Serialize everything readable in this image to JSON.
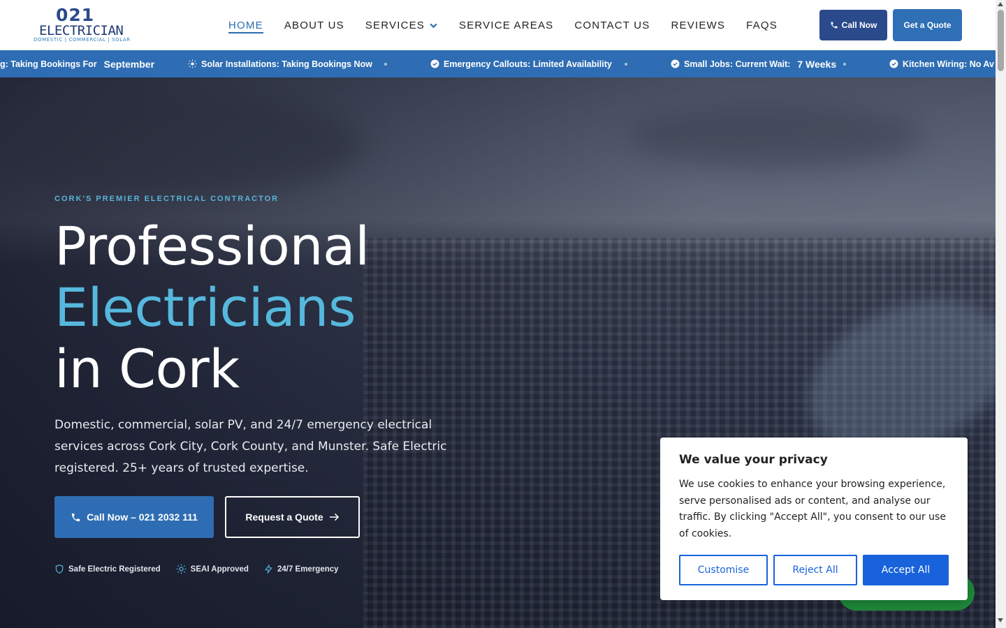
{
  "logo": {
    "number": "021",
    "word": "ELECTRICIAN",
    "tagline": "DOMESTIC | COMMERCIAL | SOLAR"
  },
  "nav": {
    "items": [
      {
        "label": "HOME",
        "active": true
      },
      {
        "label": "ABOUT US"
      },
      {
        "label": "SERVICES",
        "has_dropdown": true
      },
      {
        "label": "SERVICE AREAS"
      },
      {
        "label": "CONTACT US"
      },
      {
        "label": "REVIEWS"
      },
      {
        "label": "FAQS"
      }
    ]
  },
  "header": {
    "call_label": "Call Now",
    "quote_label": "Get a Quote"
  },
  "ticker": {
    "items": [
      {
        "text": "g: Taking Bookings For",
        "strong": "September"
      },
      {
        "text": "Solar Installations: Taking Bookings Now",
        "icon": "sun-icon"
      },
      {
        "text": "Emergency Callouts: Limited Availability",
        "icon": "check-circle-icon"
      },
      {
        "text": "Small Jobs: Current Wait:",
        "strong": "7 Weeks",
        "icon": "check-circle-icon"
      },
      {
        "text": "Kitchen Wiring: No Av",
        "icon": "check-circle-icon"
      }
    ]
  },
  "hero": {
    "eyebrow": "CORK'S PREMIER ELECTRICAL CONTRACTOR",
    "title_line1": "Professional",
    "title_line2": "Electricians",
    "title_line3": "in Cork",
    "lead": "Domestic, commercial, solar PV, and 24/7 emergency electrical services across Cork City, Cork County, and Munster. Safe Electric registered. 25+ years of trusted expertise.",
    "call_button": "Call Now – 021 2032 111",
    "quote_button": "Request a Quote",
    "badges": [
      {
        "label": "Safe Electric Registered",
        "icon": "shield-icon"
      },
      {
        "label": "SEAI Approved",
        "icon": "sun-icon"
      },
      {
        "label": "24/7 Emergency",
        "icon": "bolt-icon"
      }
    ]
  },
  "cookie": {
    "title": "We value your privacy",
    "text": "We use cookies to enhance your browsing experience, serve personalised ads or content, and analyse our traffic. By clicking \"Accept All\", you consent to our use of cookies.",
    "customise": "Customise",
    "reject": "Reject All",
    "accept": "Accept All"
  },
  "colors": {
    "brand_blue": "#2e6db3",
    "navy": "#2a4a8c",
    "accent_cyan": "#56b8dd",
    "cookie_blue": "#1863dc"
  }
}
